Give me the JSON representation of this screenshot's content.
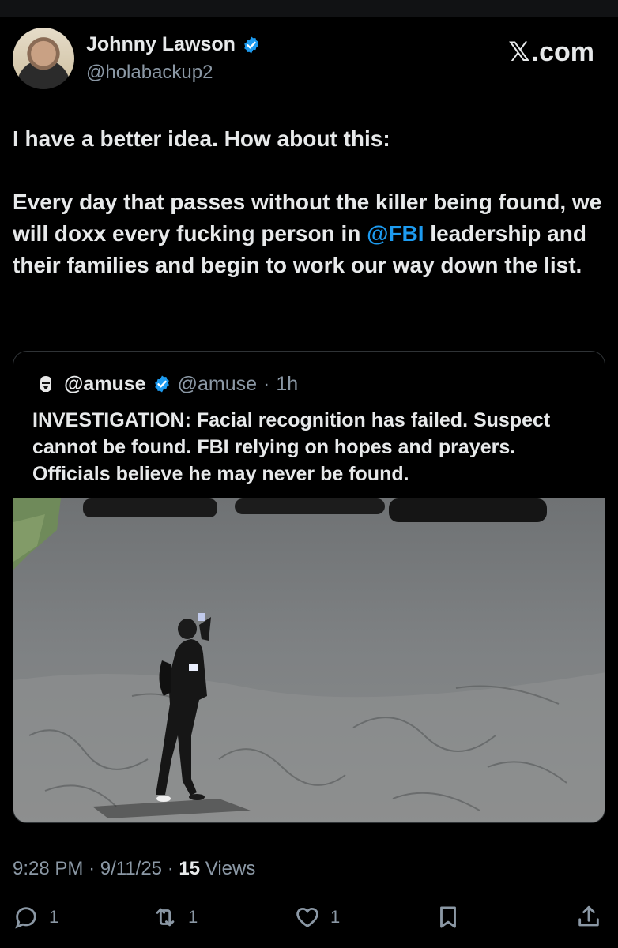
{
  "author": {
    "display_name": "Johnny Lawson",
    "handle": "@holabackup2",
    "verified": true
  },
  "brand": {
    "x_glyph": "𝕏",
    "label": ".com"
  },
  "post": {
    "line1": "I have a better idea. How about this:",
    "line2_part1": "Every day that passes without the killer being found, we will doxx every fucking person in ",
    "mention": "@FBI",
    "line2_part2": " leadership and their families and begin to work our way down the list."
  },
  "quote": {
    "display_name": "@amuse",
    "handle": "@amuse",
    "dot": "·",
    "time": "1h",
    "text": "INVESTIGATION: Facial recognition has failed. Suspect cannot be found. FBI relying on hopes and prayers. Officials believe he may never be found."
  },
  "meta": {
    "time": "9:28 PM",
    "sep1": "·",
    "date": "9/11/25",
    "sep2": "·",
    "views_count": "15",
    "views_label": "Views"
  },
  "actions": {
    "replies": "1",
    "reposts": "1",
    "likes": "1"
  },
  "colors": {
    "background": "#000000",
    "text": "#e7e9ea",
    "secondary": "#8b98a5",
    "accent": "#1d9bf0"
  }
}
